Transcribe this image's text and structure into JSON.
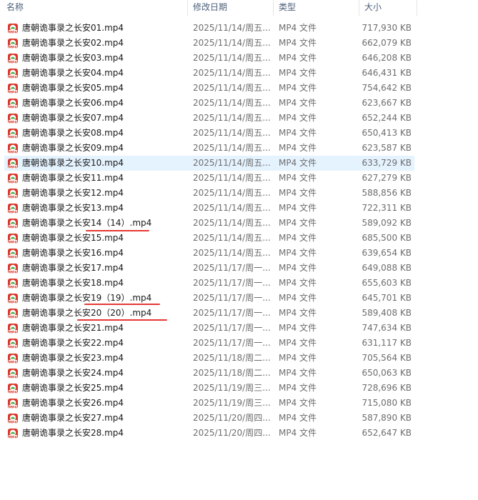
{
  "columns": {
    "name": "名称",
    "date": "修改日期",
    "type": "类型",
    "size": "大小"
  },
  "colors": {
    "header_text": "#4c607a",
    "selected_row": "#e5f3ff",
    "annotation": "#e53935",
    "icon_red": "#d9382b",
    "icon_green": "#4caf50"
  },
  "files": [
    {
      "name": "唐朝诡事录之长安01.mp4",
      "date": "2025/11/14/周五...",
      "type": "MP4 文件",
      "size": "717,930 KB"
    },
    {
      "name": "唐朝诡事录之长安02.mp4",
      "date": "2025/11/14/周五...",
      "type": "MP4 文件",
      "size": "662,079 KB"
    },
    {
      "name": "唐朝诡事录之长安03.mp4",
      "date": "2025/11/14/周五...",
      "type": "MP4 文件",
      "size": "646,208 KB"
    },
    {
      "name": "唐朝诡事录之长安04.mp4",
      "date": "2025/11/14/周五...",
      "type": "MP4 文件",
      "size": "646,431 KB"
    },
    {
      "name": "唐朝诡事录之长安05.mp4",
      "date": "2025/11/14/周五...",
      "type": "MP4 文件",
      "size": "754,642 KB"
    },
    {
      "name": "唐朝诡事录之长安06.mp4",
      "date": "2025/11/14/周五...",
      "type": "MP4 文件",
      "size": "623,667 KB"
    },
    {
      "name": "唐朝诡事录之长安07.mp4",
      "date": "2025/11/14/周五...",
      "type": "MP4 文件",
      "size": "652,244 KB"
    },
    {
      "name": "唐朝诡事录之长安08.mp4",
      "date": "2025/11/14/周五...",
      "type": "MP4 文件",
      "size": "650,413 KB"
    },
    {
      "name": "唐朝诡事录之长安09.mp4",
      "date": "2025/11/14/周五...",
      "type": "MP4 文件",
      "size": "623,587 KB"
    },
    {
      "name": "唐朝诡事录之长安10.mp4",
      "date": "2025/11/14/周五...",
      "type": "MP4 文件",
      "size": "633,729 KB",
      "selected": true
    },
    {
      "name": "唐朝诡事录之长安11.mp4",
      "date": "2025/11/14/周五...",
      "type": "MP4 文件",
      "size": "627,279 KB"
    },
    {
      "name": "唐朝诡事录之长安12.mp4",
      "date": "2025/11/14/周五...",
      "type": "MP4 文件",
      "size": "588,856 KB"
    },
    {
      "name": "唐朝诡事录之长安13.mp4",
      "date": "2025/11/14/周五...",
      "type": "MP4 文件",
      "size": "722,311 KB"
    },
    {
      "name": "唐朝诡事录之长安14（14）.mp4",
      "date": "2025/11/14/周五...",
      "type": "MP4 文件",
      "size": "589,092 KB",
      "underlined": true
    },
    {
      "name": "唐朝诡事录之长安15.mp4",
      "date": "2025/11/14/周五...",
      "type": "MP4 文件",
      "size": "685,500 KB"
    },
    {
      "name": "唐朝诡事录之长安16.mp4",
      "date": "2025/11/14/周五...",
      "type": "MP4 文件",
      "size": "639,654 KB"
    },
    {
      "name": "唐朝诡事录之长安17.mp4",
      "date": "2025/11/17/周一...",
      "type": "MP4 文件",
      "size": "649,088 KB"
    },
    {
      "name": "唐朝诡事录之长安18.mp4",
      "date": "2025/11/17/周一...",
      "type": "MP4 文件",
      "size": "655,603 KB"
    },
    {
      "name": "唐朝诡事录之长安19（19）.mp4",
      "date": "2025/11/17/周一...",
      "type": "MP4 文件",
      "size": "645,701 KB",
      "underlined": true
    },
    {
      "name": "唐朝诡事录之长安20（20）.mp4",
      "date": "2025/11/17/周一...",
      "type": "MP4 文件",
      "size": "589,408 KB",
      "underlined": true
    },
    {
      "name": "唐朝诡事录之长安21.mp4",
      "date": "2025/11/17/周一...",
      "type": "MP4 文件",
      "size": "747,634 KB"
    },
    {
      "name": "唐朝诡事录之长安22.mp4",
      "date": "2025/11/17/周一...",
      "type": "MP4 文件",
      "size": "631,117 KB"
    },
    {
      "name": "唐朝诡事录之长安23.mp4",
      "date": "2025/11/18/周二...",
      "type": "MP4 文件",
      "size": "705,564 KB"
    },
    {
      "name": "唐朝诡事录之长安24.mp4",
      "date": "2025/11/18/周二...",
      "type": "MP4 文件",
      "size": "650,063 KB"
    },
    {
      "name": "唐朝诡事录之长安25.mp4",
      "date": "2025/11/19/周三...",
      "type": "MP4 文件",
      "size": "728,696 KB"
    },
    {
      "name": "唐朝诡事录之长安26.mp4",
      "date": "2025/11/19/周三...",
      "type": "MP4 文件",
      "size": "715,080 KB"
    },
    {
      "name": "唐朝诡事录之长安27.mp4",
      "date": "2025/11/20/周四...",
      "type": "MP4 文件",
      "size": "587,890 KB"
    },
    {
      "name": "唐朝诡事录之长安28.mp4",
      "date": "2025/11/20/周四...",
      "type": "MP4 文件",
      "size": "652,647 KB"
    }
  ],
  "icon": {
    "name": "mp4-file-icon",
    "label": "MP4"
  }
}
